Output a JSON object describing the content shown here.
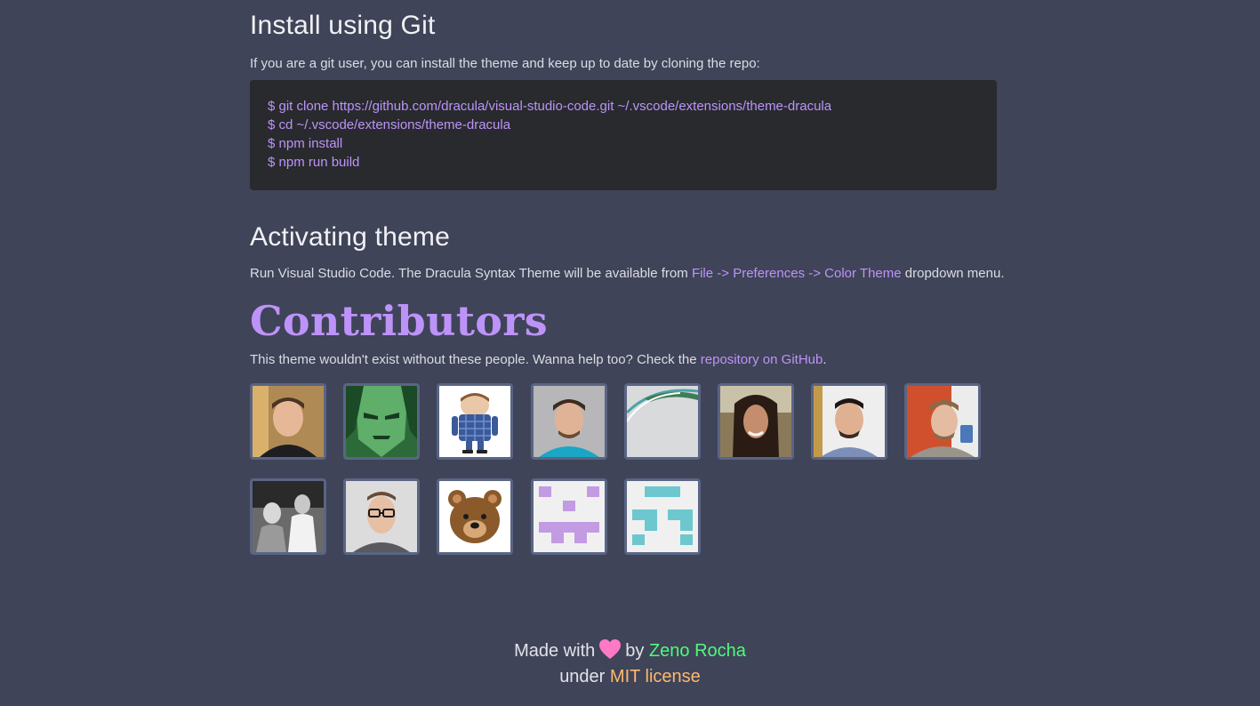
{
  "install": {
    "heading": "Install using Git",
    "intro": "If you are a git user, you can install the theme and keep up to date by cloning the repo:",
    "code_lines": [
      "$ git clone https://github.com/dracula/visual-studio-code.git ~/.vscode/extensions/theme-dracula",
      "$ cd ~/.vscode/extensions/theme-dracula",
      "$ npm install",
      "$ npm run build"
    ]
  },
  "activating": {
    "heading": "Activating theme",
    "text_before": "Run Visual Studio Code. The Dracula Syntax Theme will be available from ",
    "link": "File -> Preferences -> Color Theme",
    "text_after": " dropdown menu."
  },
  "contributors": {
    "heading": "Contributors",
    "text_before": "This theme wouldn't exist without these people. Wanna help too? Check the ",
    "link": "repository on GitHub",
    "text_after": ".",
    "avatar_count": 13
  },
  "footer": {
    "made_with": "Made with",
    "by": "by",
    "author": "Zeno Rocha",
    "under": "under",
    "license": "MIT license"
  },
  "colors": {
    "background": "#3f4458",
    "code_bg": "#282a2e",
    "purple": "#bd93f9",
    "green": "#50fa7b",
    "orange": "#ffb86c",
    "pink": "#ff79c6"
  }
}
